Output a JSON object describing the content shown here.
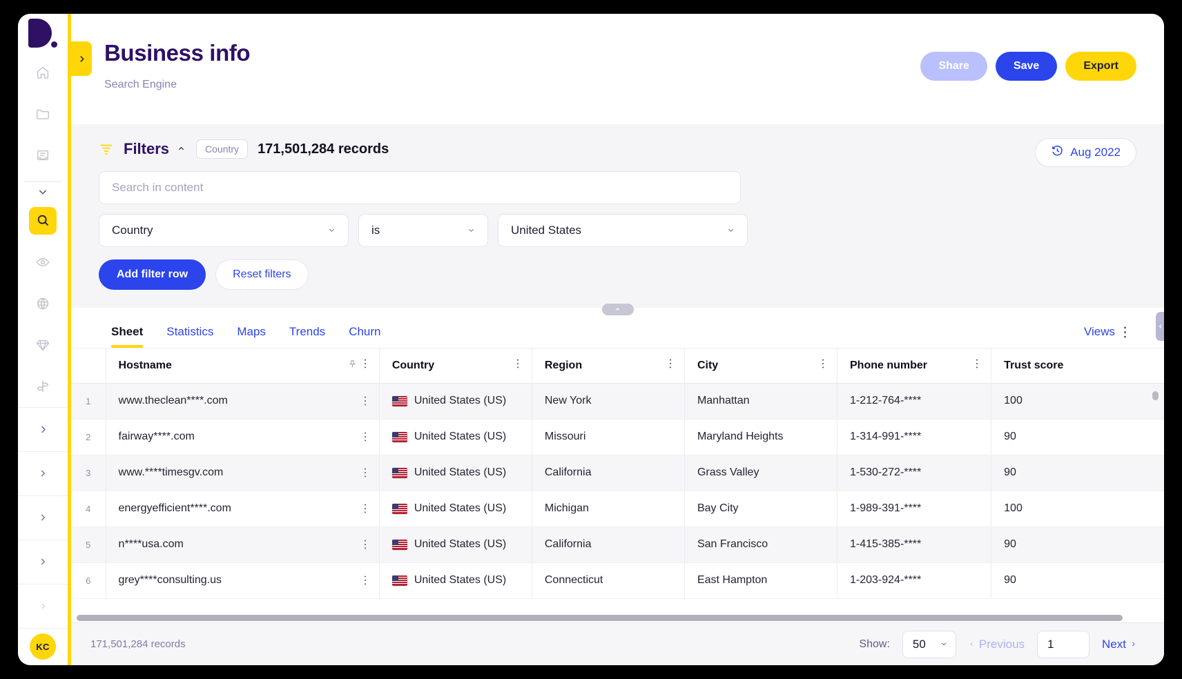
{
  "brand": {
    "logo_alt": "D.",
    "accent_yellow": "#ffd60a",
    "accent_blue": "#2b44ec",
    "accent_purple": "#2e1065"
  },
  "sidebar": {
    "icons": [
      {
        "name": "home-icon",
        "label": "Home"
      },
      {
        "name": "folder-icon",
        "label": "Folders"
      },
      {
        "name": "archive-icon",
        "label": "Archive"
      }
    ],
    "tools": [
      {
        "name": "search-icon",
        "label": "Search",
        "active": true
      },
      {
        "name": "eye-icon",
        "label": "Monitor",
        "active": false
      },
      {
        "name": "globe-icon",
        "label": "Global",
        "active": false
      },
      {
        "name": "diamond-icon",
        "label": "Premium",
        "active": false
      },
      {
        "name": "signpost-icon",
        "label": "Routes",
        "active": false
      }
    ],
    "panels": [
      {
        "name": "panel-1"
      },
      {
        "name": "panel-2"
      },
      {
        "name": "panel-3"
      },
      {
        "name": "panel-4"
      },
      {
        "name": "panel-5"
      }
    ],
    "avatar_initials": "KC"
  },
  "header": {
    "title": "Business info",
    "subtitle": "Search Engine",
    "share_label": "Share",
    "save_label": "Save",
    "export_label": "Export"
  },
  "filters": {
    "title": "Filters",
    "chip_label": "Country",
    "records_label": "171,501,284 records",
    "date_label": "Aug 2022",
    "search_placeholder": "Search in content",
    "search_value": "",
    "field_value": "Country",
    "operator_value": "is",
    "value_value": "United States",
    "add_filter_label": "Add filter row",
    "reset_label": "Reset filters"
  },
  "tabs": {
    "items": [
      {
        "label": "Sheet",
        "active": true
      },
      {
        "label": "Statistics",
        "active": false
      },
      {
        "label": "Maps",
        "active": false
      },
      {
        "label": "Trends",
        "active": false
      },
      {
        "label": "Churn",
        "active": false
      }
    ],
    "views_label": "Views"
  },
  "table": {
    "columns": [
      {
        "label": "Hostname",
        "pinnable": true
      },
      {
        "label": "Country",
        "pinnable": false
      },
      {
        "label": "Region",
        "pinnable": false
      },
      {
        "label": "City",
        "pinnable": false
      },
      {
        "label": "Phone number",
        "pinnable": false
      },
      {
        "label": "Trust score",
        "pinnable": false
      }
    ],
    "rows": [
      {
        "idx": "1",
        "hostname": "www.theclean****.com",
        "country": "United States (US)",
        "region": "New York",
        "city": "Manhattan",
        "phone": "1-212-764-****",
        "trust": "100"
      },
      {
        "idx": "2",
        "hostname": "fairway****.com",
        "country": "United States (US)",
        "region": "Missouri",
        "city": "Maryland Heights",
        "phone": "1-314-991-****",
        "trust": "90"
      },
      {
        "idx": "3",
        "hostname": "www.****timesgv.com",
        "country": "United States (US)",
        "region": "California",
        "city": "Grass Valley",
        "phone": "1-530-272-****",
        "trust": "90"
      },
      {
        "idx": "4",
        "hostname": "energyefficient****.com",
        "country": "United States (US)",
        "region": "Michigan",
        "city": "Bay City",
        "phone": "1-989-391-****",
        "trust": "100"
      },
      {
        "idx": "5",
        "hostname": "n****usa.com",
        "country": "United States (US)",
        "region": "California",
        "city": "San Francisco",
        "phone": "1-415-385-****",
        "trust": "90"
      },
      {
        "idx": "6",
        "hostname": "grey****consulting.us",
        "country": "United States (US)",
        "region": "Connecticut",
        "city": "East Hampton",
        "phone": "1-203-924-****",
        "trust": "90"
      }
    ]
  },
  "footer": {
    "records_label": "171,501,284 records",
    "show_label": "Show:",
    "page_size": "50",
    "previous_label": "Previous",
    "page_value": "1",
    "next_label": "Next"
  }
}
